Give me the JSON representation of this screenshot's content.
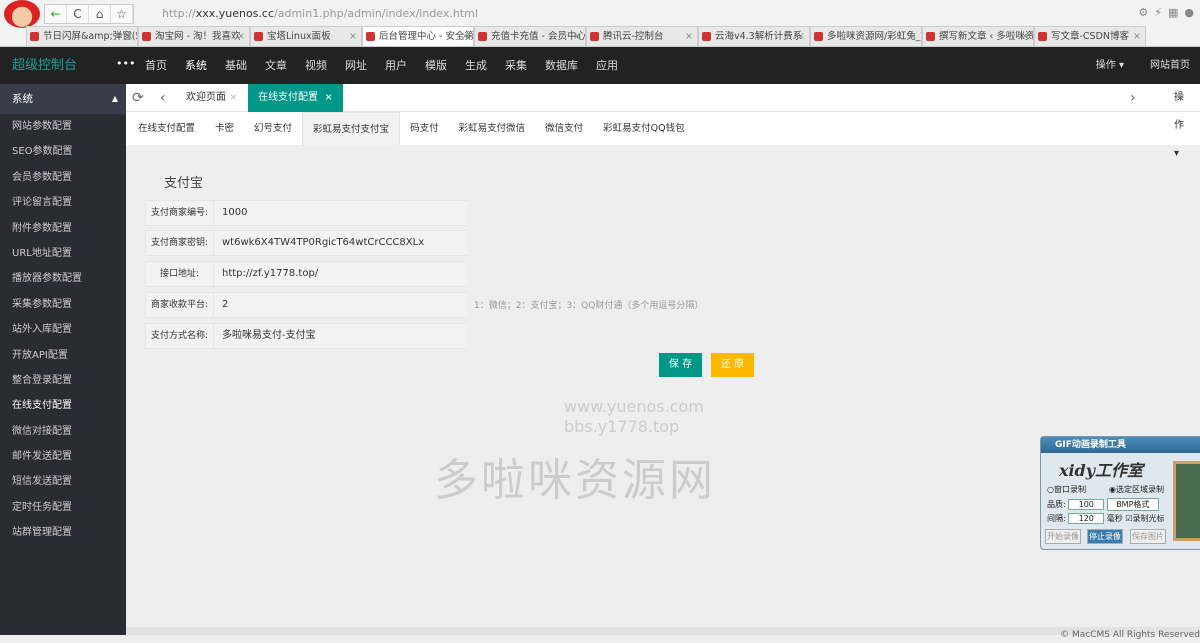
{
  "browser": {
    "url_prefix": "http://",
    "url_host": "xxx.yuenos.cc",
    "url_path": "/admin1.php/admin/index/index.html",
    "nav": [
      "←",
      "C",
      "⌂",
      "☆"
    ],
    "tabs": [
      {
        "label": "节日闪屏&amp;弹窗(5(",
        "active": false
      },
      {
        "label": "淘宝网 - 淘！我喜欢",
        "active": false
      },
      {
        "label": "宝塔Linux面板",
        "active": false
      },
      {
        "label": "后台管理中心 - 安全第",
        "active": true
      },
      {
        "label": "充值卡充值 - 会员中心",
        "active": false
      },
      {
        "label": "腾讯云-控制台",
        "active": false
      },
      {
        "label": "云海v4.3解析计费系",
        "active": false
      },
      {
        "label": "多啦咪资源网/彩虹免_Y",
        "active": false
      },
      {
        "label": "撰写新文章 ‹ 多啦咪资",
        "active": false
      },
      {
        "label": "写文章-CSDN博客",
        "active": false
      }
    ]
  },
  "header": {
    "brand": "超级控制台",
    "more": "•••",
    "menu": [
      "首页",
      "系统",
      "基础",
      "文章",
      "视频",
      "网址",
      "用户",
      "模版",
      "生成",
      "采集",
      "数据库",
      "应用"
    ],
    "active_menu": 1,
    "ops": "操作 ▾",
    "site_home": "网站首页"
  },
  "sidebar": {
    "title": "系统",
    "items": [
      "网站参数配置",
      "SEO参数配置",
      "会员参数配置",
      "评论留言配置",
      "附件参数配置",
      "URL地址配置",
      "播放器参数配置",
      "采集参数配置",
      "站外入库配置",
      "开放API配置",
      "整合登录配置",
      "在线支付配置",
      "微信对接配置",
      "邮件发送配置",
      "短信发送配置",
      "定时任务配置",
      "站群管理配置"
    ],
    "active": 11
  },
  "page_tabs": {
    "items": [
      "欢迎页面",
      "在线支付配置"
    ],
    "active": 1,
    "ops": "操作 ▾"
  },
  "sub_tabs": {
    "items": [
      "在线支付配置",
      "卡密",
      "幻号支付",
      "彩虹易支付支付宝",
      "码支付",
      "彩虹易支付微信",
      "微信支付",
      "彩虹易支付QQ钱包"
    ],
    "active": 3
  },
  "form": {
    "section": "支付宝",
    "rows": [
      {
        "label": "支付商家编号:",
        "value": "1000"
      },
      {
        "label": "支付商家密钥:",
        "value": "wt6wk6X4TW4TP0RgicT64wtCrCCC8XLx"
      },
      {
        "label": "接口地址:",
        "value": "http://zf.y1778.top/"
      },
      {
        "label": "商家收款平台:",
        "value": "2"
      },
      {
        "label": "支付方式名称:",
        "value": "多啦咪易支付-支付宝"
      }
    ],
    "hint": "1：微信；2：支付宝；3：QQ财付通（多个用逗号分隔）",
    "save": "保 存",
    "reset": "还 原"
  },
  "watermark": {
    "line1": "www.yuenos.com",
    "line2": "bbs.y1778.top",
    "big": "多啦咪资源网"
  },
  "footer": "© MacCMS All Rights Reserved",
  "gif_tool": {
    "title": "GIF动画录制工具",
    "logo": "xidy工作室",
    "window": "窗口录制",
    "region": "选定区域录制",
    "quality_label": "品质:",
    "quality": "100",
    "format": "BMP格式",
    "interval_label": "间隔:",
    "interval": "120",
    "ms": "毫秒",
    "cursor": "录制光标",
    "start": "开始录像",
    "stop": "停止录像",
    "save": "保存图片"
  },
  "colors": {
    "accent": "#009688",
    "warn": "#FFB800",
    "topbar": "#222222",
    "sidebar": "#2b2b33"
  }
}
